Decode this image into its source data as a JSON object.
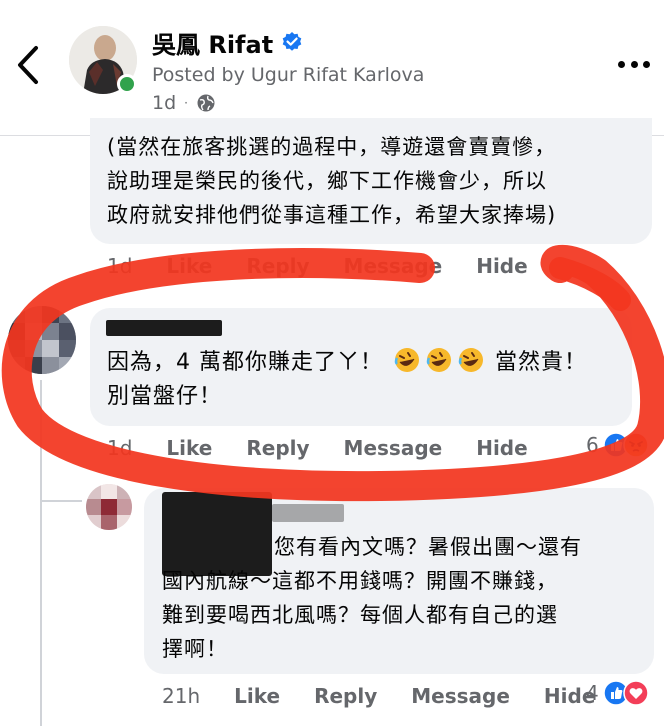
{
  "header": {
    "page_name": "吳鳳 Rifat",
    "posted_by": "Posted by Ugur Rifat Karlova",
    "time": "1d"
  },
  "comment1": {
    "lines": [
      "(當然在旅客挑選的過程中，導遊還會賣賣慘，",
      "說助理是榮民的後代，鄉下工作機會少，所以",
      "政府就安排他們從事這種工作，希望大家捧場)"
    ],
    "time": "1d",
    "like": "Like",
    "reply": "Reply",
    "message": "Message",
    "hide": "Hide"
  },
  "comment2": {
    "line1_a": "因為，4 萬都你賺走了ㄚ！",
    "line1_b": "當然貴！",
    "line2": "別當盤仔！",
    "emoji_count": 3,
    "time": "1d",
    "like": "Like",
    "reply": "Reply",
    "message": "Message",
    "hide": "Hide",
    "reaction_count": "6",
    "reactions": [
      "like-icon",
      "angry-icon"
    ]
  },
  "comment3": {
    "lines": [
      "您有看內文嗎？暑假出團～還有",
      "國內航線～這都不用錢嗎？開團不賺錢，",
      "難到要喝西北風嗎？每個人都有自己的選",
      "擇啊！"
    ],
    "time": "21h",
    "like": "Like",
    "reply": "Reply",
    "message": "Message",
    "hide": "Hide",
    "reaction_count": "4",
    "reactions": [
      "like-icon",
      "love-icon"
    ]
  },
  "colors": {
    "link_gray": "#65676b",
    "bubble": "#f0f2f5",
    "annotation_red": "#f2361f",
    "fb_blue": "#1877f2",
    "online_green": "#31a24c"
  }
}
